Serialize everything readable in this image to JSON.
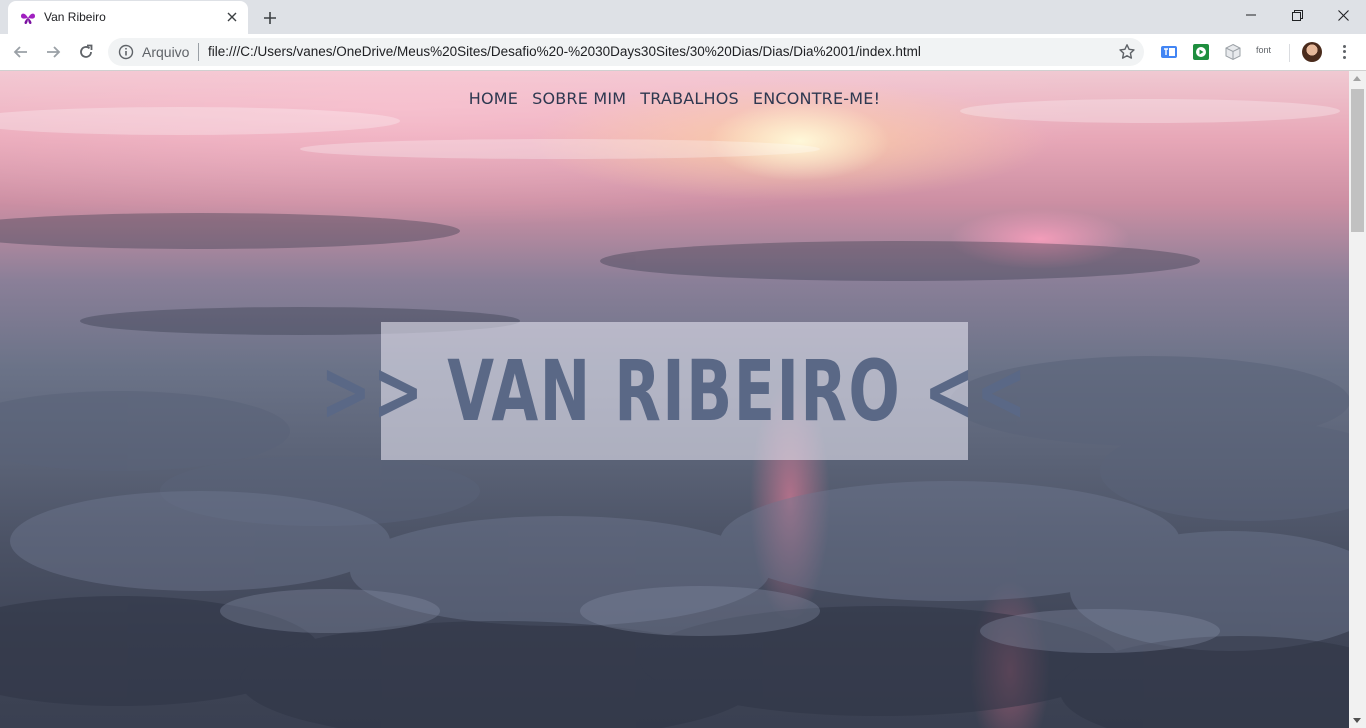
{
  "browser": {
    "tab": {
      "title": "Van Ribeiro",
      "favicon": "butterfly-icon"
    },
    "new_tab": "+",
    "address_bar": {
      "scheme_label": "Arquivo",
      "url": "file:///C:/Users/vanes/OneDrive/Meus%20Sites/Desafio%20-%2030Days30Sites/30%20Dias/Dias/Dia%2001/index.html"
    },
    "extensions": {
      "font_label": "font"
    }
  },
  "page": {
    "nav": [
      "HOME",
      "SOBRE MIM",
      "TRABALHOS",
      "ENCONTRE-ME!"
    ],
    "hero_title": ">> VAN RIBEIRO <<"
  },
  "colors": {
    "nav_text": "#2e3850",
    "hero_text": "#5a6886",
    "favicon": "#a020c0"
  }
}
